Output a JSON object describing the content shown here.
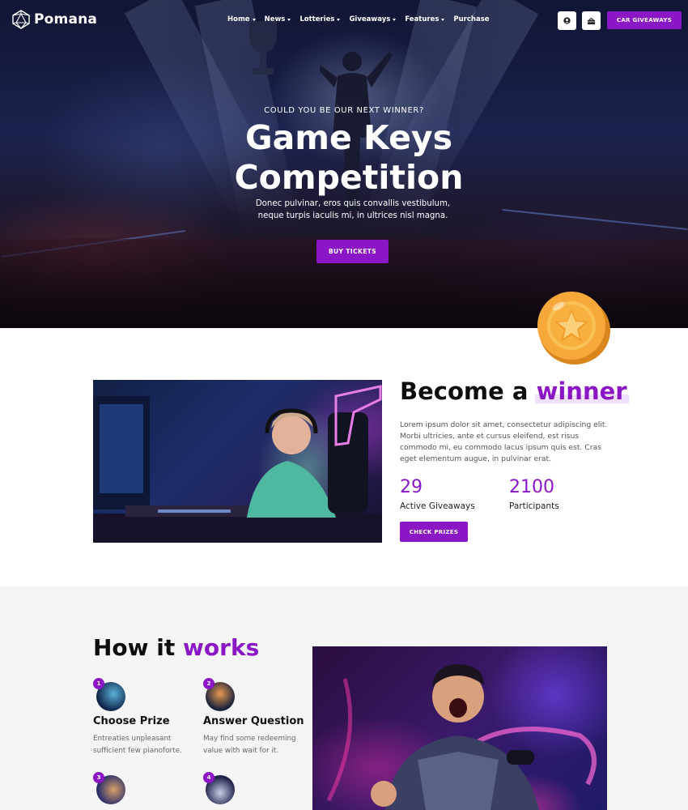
{
  "brand": {
    "name": "Pomana"
  },
  "nav": {
    "items": [
      {
        "label": "Home",
        "has_dropdown": true
      },
      {
        "label": "News",
        "has_dropdown": true
      },
      {
        "label": "Lotteries",
        "has_dropdown": true
      },
      {
        "label": "Giveaways",
        "has_dropdown": true
      },
      {
        "label": "Features",
        "has_dropdown": true
      },
      {
        "label": "Purchase",
        "has_dropdown": false
      }
    ],
    "account_icon": "user-icon",
    "cart_icon": "basket-icon",
    "cta_label": "CAR GIVEAWAYS"
  },
  "hero": {
    "eyebrow": "COULD YOU BE OUR NEXT WINNER?",
    "title_line1": "Game Keys",
    "title_line2": "Competition",
    "desc_line1": "Donec pulvinar, eros quis convallis vestibulum,",
    "desc_line2": "neque turpis iaculis mi, in ultrices nisl magna.",
    "button_label": "BUY TICKETS"
  },
  "winner": {
    "title_plain": "Become a",
    "title_highlight": "winner",
    "description": "Lorem ipsum dolor sit amet, consectetur adipiscing elit. Morbi ultricies, ante et cursus eleifend, est risus commodo mi, eu commodo lacus ipsum quis est. Cras eget elementum augue, in pulvinar erat.",
    "stats": [
      {
        "value": "29",
        "label": "Active Giveaways"
      },
      {
        "value": "2100",
        "label": "Participants"
      }
    ],
    "button_label": "CHECK PRIZES"
  },
  "how": {
    "title_plain": "How it",
    "title_highlight": "works",
    "steps": [
      {
        "number": "1",
        "title": "Choose Prize",
        "desc": "Entreaties unpleasant sufficient few pianoforte."
      },
      {
        "number": "2",
        "title": "Answer Question",
        "desc": "May find some redeeming value with wait for it."
      },
      {
        "number": "3"
      },
      {
        "number": "4"
      }
    ]
  },
  "colors": {
    "accent": "#8b16c5",
    "highlight_bg": "#efe0fb",
    "section_bg": "#f5f5f6",
    "coin": "#f5a623"
  }
}
